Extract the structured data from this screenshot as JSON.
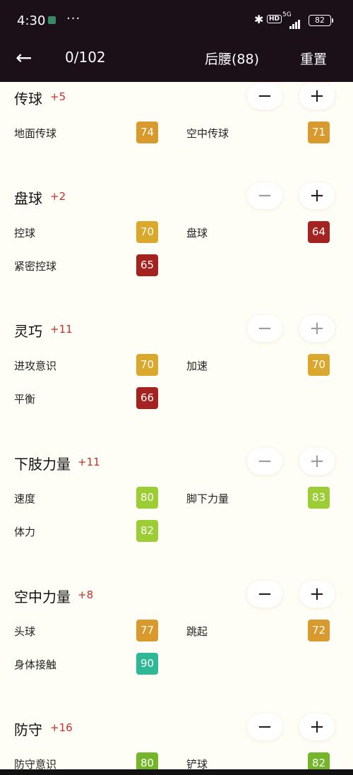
{
  "status": {
    "time": "4:30",
    "net": "5G",
    "hd": "HD",
    "battery": "82"
  },
  "header": {
    "counter": "0/102",
    "position": "后腰(88)",
    "reset": "重置"
  },
  "sections": [
    {
      "title": "传球",
      "bonus": "+5",
      "attrs": [
        {
          "label": "地面传球",
          "value": "74",
          "color": "#d89a2c"
        },
        {
          "label": "空中传球",
          "value": "71",
          "color": "#d89a2c"
        }
      ]
    },
    {
      "title": "盘球",
      "bonus": "+2",
      "attrs": [
        {
          "label": "控球",
          "value": "70",
          "color": "#dba82e"
        },
        {
          "label": "盘球",
          "value": "64",
          "color": "#a4221f"
        },
        {
          "label": "紧密控球",
          "value": "65",
          "color": "#a4221f"
        }
      ]
    },
    {
      "title": "灵巧",
      "bonus": "+11",
      "attrs": [
        {
          "label": "进攻意识",
          "value": "70",
          "color": "#dba82e"
        },
        {
          "label": "加速",
          "value": "70",
          "color": "#dba82e"
        },
        {
          "label": "平衡",
          "value": "66",
          "color": "#a4221f"
        }
      ]
    },
    {
      "title": "下肢力量",
      "bonus": "+11",
      "attrs": [
        {
          "label": "速度",
          "value": "80",
          "color": "#9ccd34"
        },
        {
          "label": "脚下力量",
          "value": "83",
          "color": "#9ccd34"
        },
        {
          "label": "体力",
          "value": "82",
          "color": "#9ccd34"
        }
      ]
    },
    {
      "title": "空中力量",
      "bonus": "+8",
      "attrs": [
        {
          "label": "头球",
          "value": "77",
          "color": "#d89a2c"
        },
        {
          "label": "跳起",
          "value": "72",
          "color": "#d89a2c"
        },
        {
          "label": "身体接触",
          "value": "90",
          "color": "#2fb896"
        }
      ]
    },
    {
      "title": "防守",
      "bonus": "+16",
      "attrs": [
        {
          "label": "防守意识",
          "value": "80",
          "color": "#74b52a"
        },
        {
          "label": "铲球",
          "value": "82",
          "color": "#74b52a"
        }
      ]
    }
  ],
  "minus_symbol": "−",
  "plus_symbol": "+"
}
